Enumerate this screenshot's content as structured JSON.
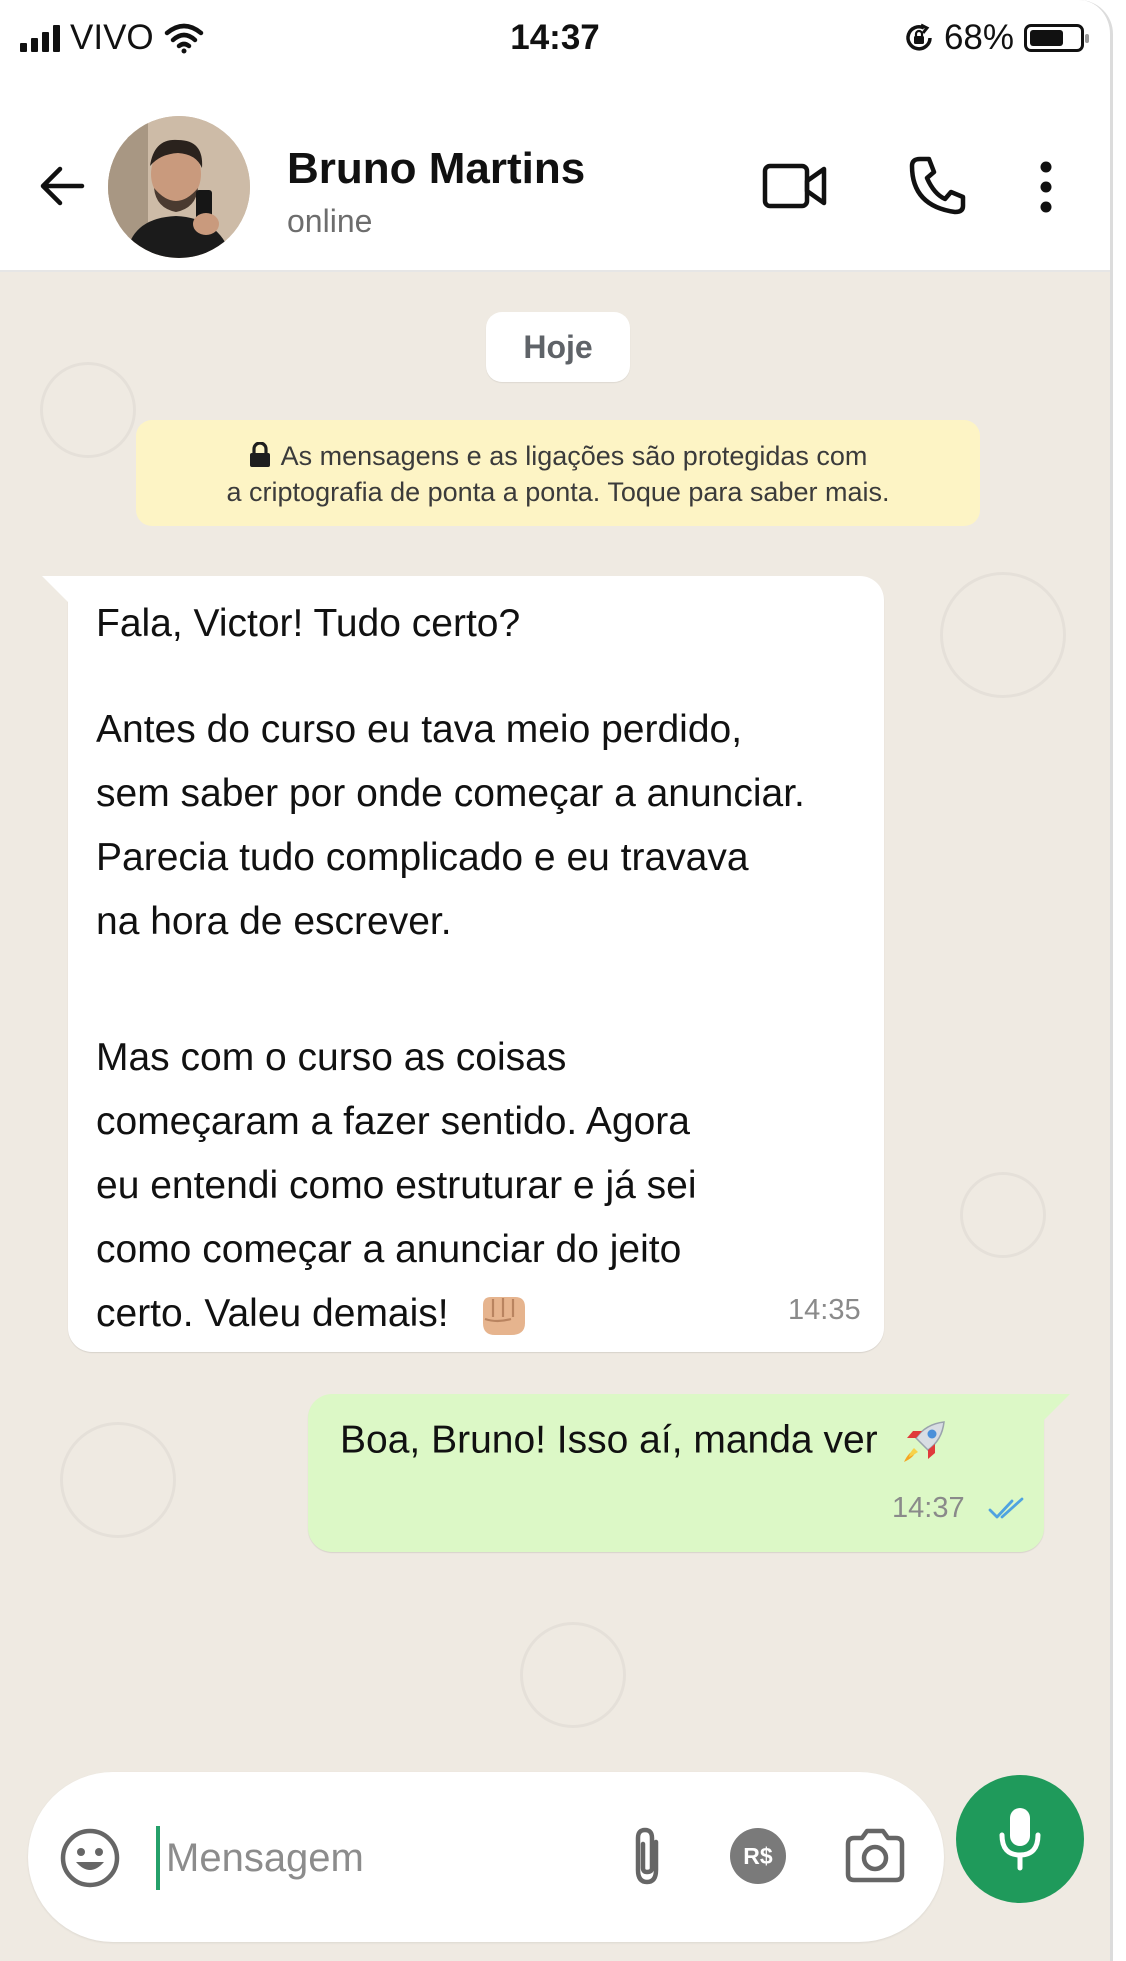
{
  "status_bar": {
    "carrier": "VIVO",
    "time": "14:37",
    "battery": "68%",
    "battery_level": 0.68,
    "icons": [
      "signal-icon",
      "wifi-icon",
      "rotation-lock-icon",
      "battery-icon"
    ]
  },
  "header": {
    "contact_name": "Bruno Martins",
    "presence": "online",
    "icons": [
      "back-arrow-icon",
      "video-call-icon",
      "phone-icon",
      "more-options-icon"
    ]
  },
  "chat": {
    "day_divider": "Hoje",
    "encryption_notice": {
      "line1": "As mensagens e as ligações são protegidas com",
      "line2": "a criptografia de ponta a ponta. Toque para saber mais."
    },
    "messages": [
      {
        "direction": "incoming",
        "paragraphs": [
          [
            "Fala, Victor! Tudo certo?"
          ],
          [
            "Antes do curso eu tava meio perdido,",
            "sem saber por onde começar a anunciar.",
            "Parecia tudo complicado e eu travava",
            "na hora de escrever."
          ],
          [
            "Mas com o curso as coisas",
            "começaram a fazer sentido. Agora",
            "eu entendi como estruturar e já sei",
            "como começar a anunciar do jeito",
            "certo. Valeu demais!"
          ]
        ],
        "emoji": "fist-bump-emoji",
        "time": "14:35"
      },
      {
        "direction": "outgoing",
        "text": "Boa, Bruno! Isso aí, manda ver",
        "emoji": "rocket-emoji",
        "time": "14:37",
        "status": "read"
      }
    ]
  },
  "composer": {
    "placeholder": "Mensagem",
    "value": "",
    "payment_icon_label": "R$",
    "icons": [
      "emoji-icon",
      "attach-icon",
      "payment-icon",
      "camera-icon",
      "mic-icon"
    ]
  },
  "colors": {
    "chat_background": "#efeae2",
    "outgoing_bubble": "#dcf8c6",
    "incoming_bubble": "#ffffff",
    "encryption_banner": "#fdf4c5",
    "mic_button": "#1f9a5b",
    "read_ticks": "#4fa3e0"
  }
}
